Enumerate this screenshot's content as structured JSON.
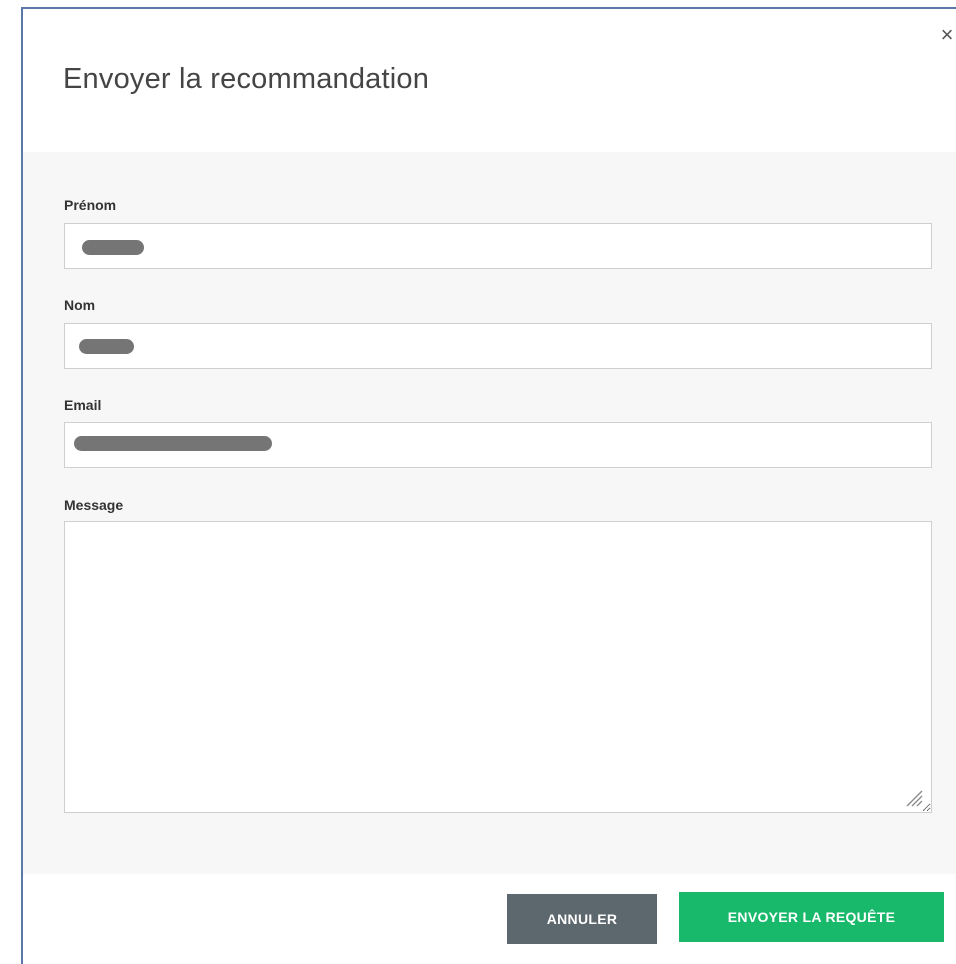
{
  "dialog": {
    "title": "Envoyer la recommandation",
    "close_symbol": "×"
  },
  "form": {
    "first_name": {
      "label": "Prénom",
      "value": ""
    },
    "last_name": {
      "label": "Nom",
      "value": ""
    },
    "email": {
      "label": "Email",
      "value": ""
    },
    "message": {
      "label": "Message",
      "value": ""
    }
  },
  "footer": {
    "cancel_label": "ANNULER",
    "send_label": "ENVOYER LA REQUÊTE"
  },
  "colors": {
    "primary": "#18b96a",
    "secondary": "#5d676e",
    "panel": "#f7f7f7"
  },
  "icons": [
    "close-icon",
    "resize-grip-icon"
  ]
}
